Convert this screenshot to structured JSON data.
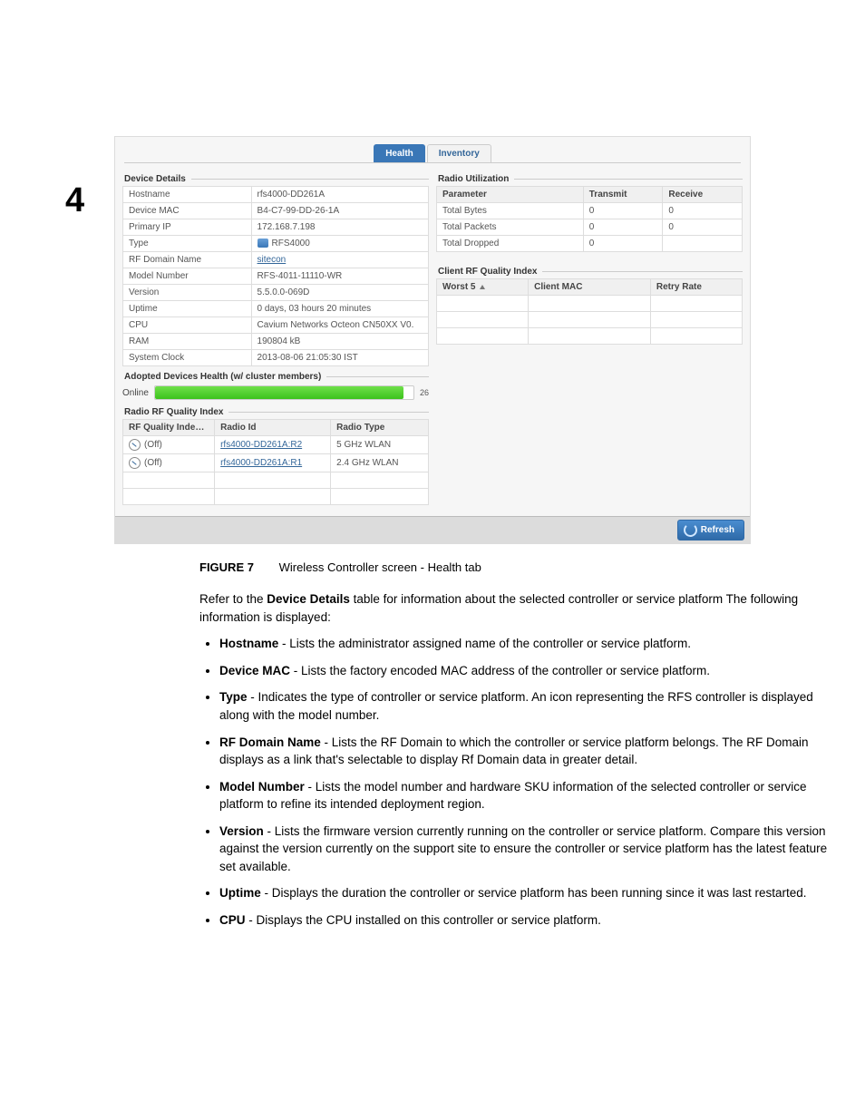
{
  "page_number": "4",
  "screenshot": {
    "tabs": {
      "health": "Health",
      "inventory": "Inventory"
    },
    "device_details": {
      "title": "Device Details",
      "rows": {
        "hostname_l": "Hostname",
        "hostname_v": "rfs4000-DD261A",
        "mac_l": "Device MAC",
        "mac_v": "B4-C7-99-DD-26-1A",
        "ip_l": "Primary IP",
        "ip_v": "172.168.7.198",
        "type_l": "Type",
        "type_v": "RFS4000",
        "rfdom_l": "RF Domain Name",
        "rfdom_v": "sitecon",
        "model_l": "Model Number",
        "model_v": "RFS-4011-11110-WR",
        "ver_l": "Version",
        "ver_v": "5.5.0.0-069D",
        "uptime_l": "Uptime",
        "uptime_v": "0 days, 03 hours 20 minutes",
        "cpu_l": "CPU",
        "cpu_v": "Cavium Networks Octeon CN50XX V0.",
        "ram_l": "RAM",
        "ram_v": "190804 kB",
        "clock_l": "System Clock",
        "clock_v": "2013-08-06 21:05:30 IST"
      }
    },
    "radio_util": {
      "title": "Radio Utilization",
      "headers": {
        "param": "Parameter",
        "tx": "Transmit",
        "rx": "Receive"
      },
      "rows": {
        "bytes_l": "Total Bytes",
        "bytes_tx": "0",
        "bytes_rx": "0",
        "pkts_l": "Total Packets",
        "pkts_tx": "0",
        "pkts_rx": "0",
        "drop_l": "Total Dropped",
        "drop_tx": "0"
      }
    },
    "client_rfq": {
      "title": "Client RF Quality Index",
      "headers": {
        "worst5": "Worst 5",
        "mac": "Client MAC",
        "retry": "Retry Rate"
      }
    },
    "adopted": {
      "title": "Adopted Devices Health (w/ cluster members)",
      "online_label": "Online",
      "bar_value": "26"
    },
    "radio_rfq": {
      "title": "Radio RF Quality Index",
      "headers": {
        "idx": "RF Quality Index",
        "id": "Radio Id",
        "type": "Radio Type"
      },
      "rows": {
        "r1_status": "(Off)",
        "r1_id": "rfs4000-DD261A:R2",
        "r1_type": "5 GHz WLAN",
        "r2_status": "(Off)",
        "r2_id": "rfs4000-DD261A:R1",
        "r2_type": "2.4 GHz WLAN"
      }
    },
    "refresh": "Refresh"
  },
  "caption": {
    "label": "FIGURE 7",
    "text": "Wireless Controller screen - Health tab"
  },
  "body": {
    "intro1": "Refer to the ",
    "intro1_bold": "Device Details",
    "intro1_tail": " table for information about the selected controller or service platform The following information is displayed:",
    "bullets": {
      "b1_bold": "Hostname",
      "b1": " - Lists the administrator assigned name of the controller or service platform.",
      "b2_bold": "Device MAC",
      "b2": " - Lists the factory encoded MAC address of the controller or service platform.",
      "b3_bold": "Type",
      "b3": " - Indicates the type of controller or service platform. An icon representing the RFS controller is displayed along with the model number.",
      "b4_bold": "RF Domain Name",
      "b4": " - Lists the RF Domain to which the controller or service platform belongs. The RF Domain displays as a link that's selectable to display Rf Domain data in greater detail.",
      "b5_bold": "Model Number",
      "b5": " - Lists the model number and hardware SKU information of the selected controller or service platform to refine its intended deployment region.",
      "b6_bold": "Version",
      "b6": " - Lists the firmware version currently running on the controller or service platform. Compare this version against the version currently on the support site to ensure the controller or service platform has the latest feature set available.",
      "b7_bold": "Uptime",
      "b7": " - Displays the duration the controller or service platform has been running since it was last restarted.",
      "b8_bold": "CPU",
      "b8": " - Displays the CPU installed on this controller or service platform."
    }
  }
}
